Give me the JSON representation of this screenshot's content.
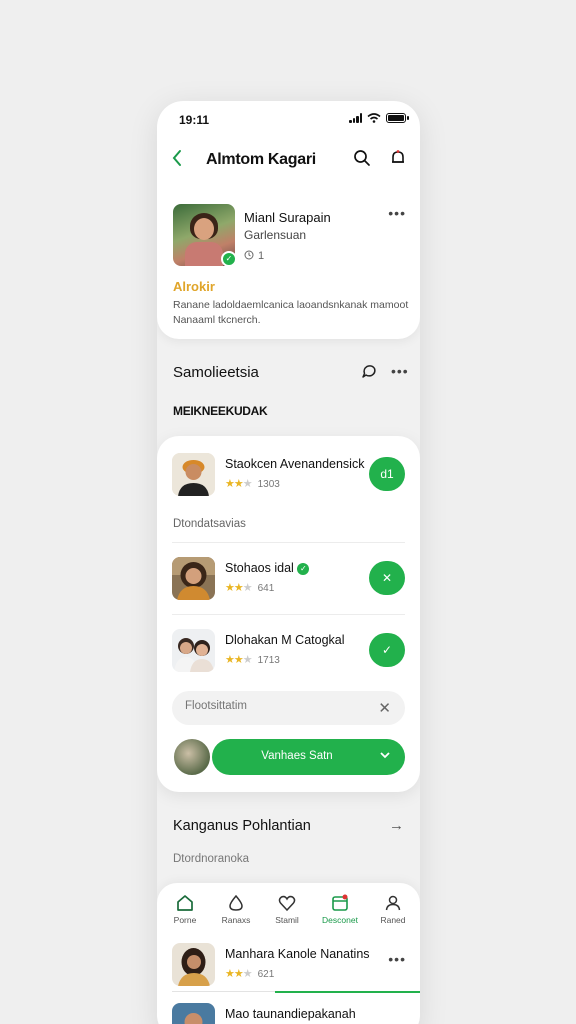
{
  "status_bar": {
    "time": "19:11"
  },
  "header": {
    "title": "Almtom Kagari"
  },
  "profile": {
    "name": "Mianl Surapain",
    "subtitle": "Garlensuan",
    "count": "1",
    "tag": "Alrokir",
    "description": "Ranane ladoldaemlcanica laoandsnkanak mamoot Nanaaml tkcnerch."
  },
  "section_title": "Samolieetsia",
  "section_subtitle": "MEIKNEEKUDAK",
  "rows": [
    {
      "name": "Staokcen Avenandensick",
      "rating": "1303",
      "stars": 2.5,
      "button_icon": "d1"
    },
    {
      "name": "Stohaos idal",
      "rating": "641",
      "stars": 2,
      "button_icon": "✕"
    },
    {
      "name": "Dlohakan M Catogkal",
      "rating": "1713",
      "stars": 2,
      "button_icon": "✓"
    }
  ],
  "rows_sublabel": "Dtondatsavias",
  "search": {
    "placeholder": "Flootsittatim"
  },
  "cta": {
    "label": "Vanhaes Satn"
  },
  "section3": {
    "title": "Kanganus Pohlantian",
    "subtitle": "Dtordnoranoka"
  },
  "tabs": [
    {
      "label": "Porne",
      "icon": "home-icon"
    },
    {
      "label": "Ranaxs",
      "icon": "drop-icon"
    },
    {
      "label": "Stamil",
      "icon": "heart-icon"
    },
    {
      "label": "Desconet",
      "icon": "calendar-icon",
      "active": true
    },
    {
      "label": "Raned",
      "icon": "user-icon"
    }
  ],
  "list": [
    {
      "name": "Manhara Kanole Nanatins",
      "rating": "621"
    },
    {
      "name": "Mao taunandiepakanah"
    }
  ],
  "colors": {
    "accent": "#22b14c",
    "star": "#e9b523",
    "tag": "#e0a52a"
  }
}
